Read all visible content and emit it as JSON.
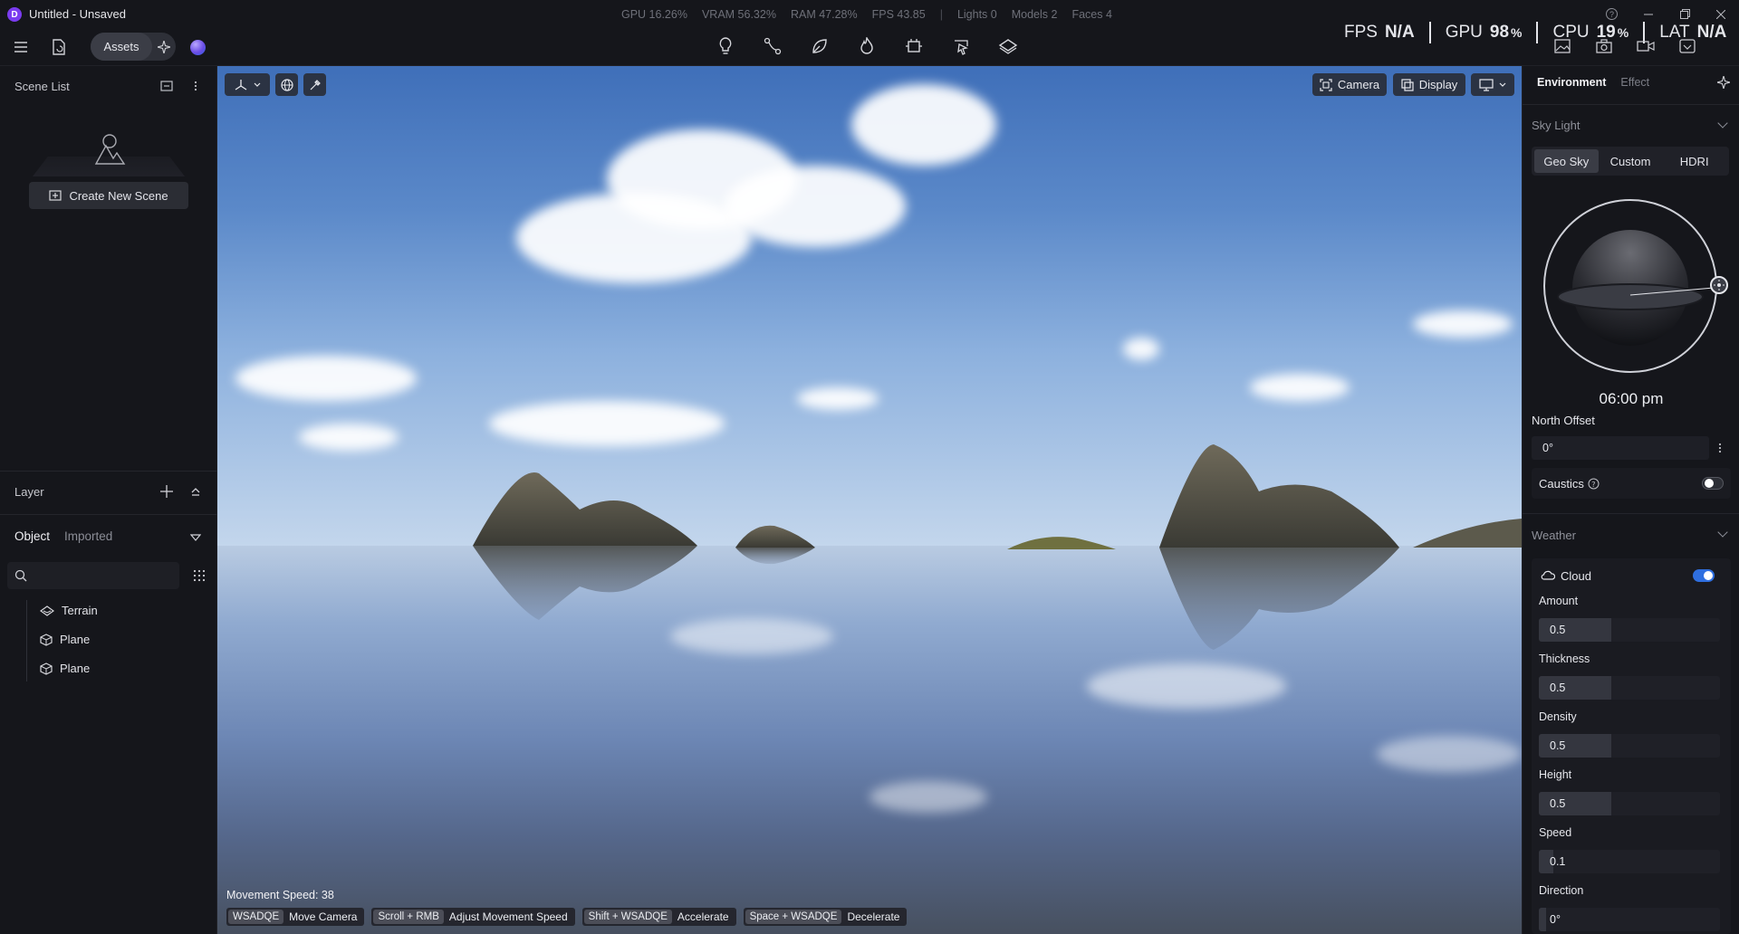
{
  "window": {
    "title": "Untitled - Unsaved",
    "logo_letter": "D"
  },
  "stats": {
    "gpu": "GPU 16.26%",
    "vram": "VRAM 56.32%",
    "ram": "RAM 47.28%",
    "fps": "FPS 43.85",
    "separator": "|",
    "lights": "Lights 0",
    "models": "Models 2",
    "faces": "Faces 4"
  },
  "perf_overlay": {
    "fps_label": "FPS",
    "fps_value": "N/A",
    "gpu_label": "GPU",
    "gpu_value": "98",
    "gpu_unit": "%",
    "cpu_label": "CPU",
    "cpu_value": "19",
    "cpu_unit": "%",
    "lat_label": "LAT",
    "lat_value": "N/A"
  },
  "toolbar": {
    "assets_label": "Assets"
  },
  "left_panel": {
    "scene_list_title": "Scene List",
    "create_scene_label": "Create New Scene",
    "layer_title": "Layer",
    "tabs": {
      "object": "Object",
      "imported": "Imported"
    },
    "search_placeholder": "",
    "tree": [
      {
        "label": "Terrain",
        "icon": "terrain-icon"
      },
      {
        "label": "Plane",
        "icon": "cube-icon"
      },
      {
        "label": "Plane",
        "icon": "cube-icon"
      }
    ]
  },
  "viewport": {
    "camera_label": "Camera",
    "display_label": "Display",
    "movement_speed": "Movement Speed: 38",
    "hints": [
      {
        "key": "WSADQE",
        "action": "Move Camera"
      },
      {
        "key": "Scroll + RMB",
        "action": "Adjust Movement Speed"
      },
      {
        "key": "Shift + WSADQE",
        "action": "Accelerate"
      },
      {
        "key": "Space + WSADQE",
        "action": "Decelerate"
      }
    ]
  },
  "right_panel": {
    "tabs": {
      "environment": "Environment",
      "effect": "Effect"
    },
    "sky_light_title": "Sky Light",
    "sky_modes": [
      "Geo Sky",
      "Custom",
      "HDRI"
    ],
    "sky_mode_selected": "Geo Sky",
    "time": "06:00 pm",
    "north_offset_label": "North Offset",
    "north_offset_value": "0°",
    "caustics_label": "Caustics",
    "caustics_enabled": false,
    "weather_title": "Weather",
    "cloud_label": "Cloud",
    "cloud_enabled": true,
    "params": [
      {
        "label": "Amount",
        "value": "0.5",
        "fraction": 0.4
      },
      {
        "label": "Thickness",
        "value": "0.5",
        "fraction": 0.4
      },
      {
        "label": "Density",
        "value": "0.5",
        "fraction": 0.4
      },
      {
        "label": "Height",
        "value": "0.5",
        "fraction": 0.4
      },
      {
        "label": "Speed",
        "value": "0.1",
        "fraction": 0.08
      },
      {
        "label": "Direction",
        "value": "0°",
        "fraction": 0.0
      }
    ],
    "accent_color": "#2f6fe0"
  }
}
